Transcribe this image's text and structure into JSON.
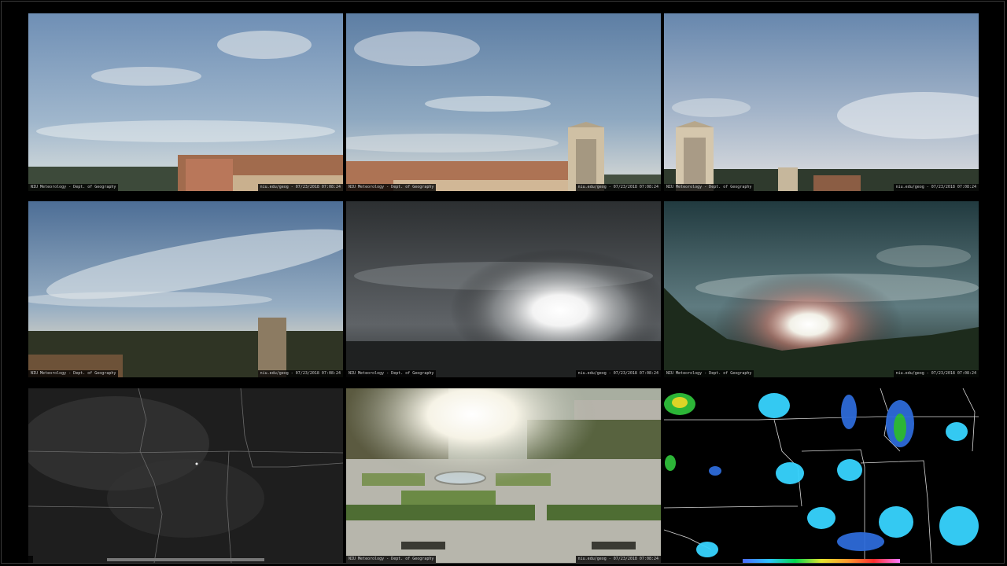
{
  "tiles": [
    {
      "id": "cam-1",
      "caption_left": "NIU Meteorology - Dept. of Geography",
      "caption_right": "niu.edu/geog - 07/23/2018 07:08:24"
    },
    {
      "id": "cam-2",
      "caption_left": "NIU Meteorology - Dept. of Geography",
      "caption_right": "niu.edu/geog - 07/23/2018 07:08:24"
    },
    {
      "id": "cam-3",
      "caption_left": "NIU Meteorology - Dept. of Geography",
      "caption_right": "niu.edu/geog - 07/23/2018 07:08:24"
    },
    {
      "id": "cam-4",
      "caption_left": "NIU Meteorology - Dept. of Geography",
      "caption_right": "niu.edu/geog - 07/23/2018 07:08:24"
    },
    {
      "id": "cam-5",
      "caption_left": "NIU Meteorology - Dept. of Geography",
      "caption_right": "niu.edu/geog - 07/23/2018 07:08:24"
    },
    {
      "id": "cam-6",
      "caption_left": "NIU Meteorology - Dept. of Geography",
      "caption_right": "niu.edu/geog - 07/23/2018 07:08:24"
    },
    {
      "id": "satellite",
      "caption_left": "",
      "caption_right": ""
    },
    {
      "id": "cam-plaza",
      "caption_left": "NIU Meteorology - Dept. of Geography",
      "caption_right": "niu.edu/geog - 07/23/2018 07:08:24"
    },
    {
      "id": "radar",
      "caption_left": "",
      "caption_right": ""
    }
  ],
  "colors": {
    "background": "#000000",
    "sky_blue": "#8aa6c4",
    "sun_white": "#ffffff",
    "radar_cyan": "#37d4ff",
    "radar_blue": "#2e6bd9",
    "radar_green": "#2fbf3a",
    "radar_yellow": "#e8e02a"
  }
}
